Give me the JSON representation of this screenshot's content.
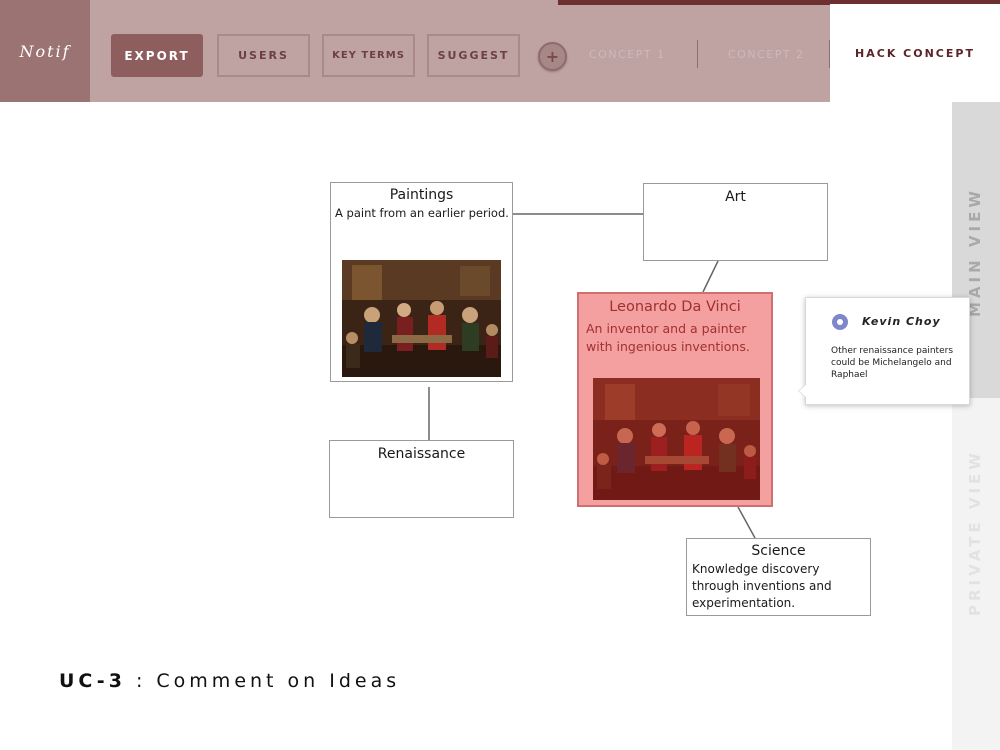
{
  "app": {
    "brand": "Notif"
  },
  "toolbar": {
    "export_label": "EXPORT",
    "users_label": "USERS",
    "key_terms_label": "KEY TERMS",
    "suggest_label": "SUGGEST",
    "add_icon": "plus-circle-icon"
  },
  "tabs": {
    "concept1": "CONCEPT 1",
    "concept2": "CONCEPT 2",
    "active": "HACK CONCEPT"
  },
  "views": {
    "main": "MAIN VIEW",
    "private": "PRIVATE VIEW"
  },
  "nodes": {
    "paintings": {
      "title": "Paintings",
      "desc": "A paint from an earlier period."
    },
    "art": {
      "title": "Art",
      "desc": ""
    },
    "renaissance": {
      "title": "Renaissance",
      "desc": ""
    },
    "davinci": {
      "title": "Leonardo Da Vinci",
      "desc": "An inventor and a painter with ingenious inventions."
    },
    "science": {
      "title": "Science",
      "desc": "Knowledge discovery through inventions and experimentation."
    }
  },
  "comment": {
    "author": "Kevin Choy",
    "text": "Other renaissance painters could be Michelangelo and Raphael"
  },
  "caption": {
    "code": "UC-3",
    "text": ": Comment on Ideas"
  },
  "colors": {
    "topbar": "#bfa3a3",
    "brand_block": "#9c7373",
    "accent": "#6e2f30",
    "primary_button": "#8e5e5f",
    "highlight_node": "#f4a0a0",
    "avatar": "#7f86c9"
  }
}
